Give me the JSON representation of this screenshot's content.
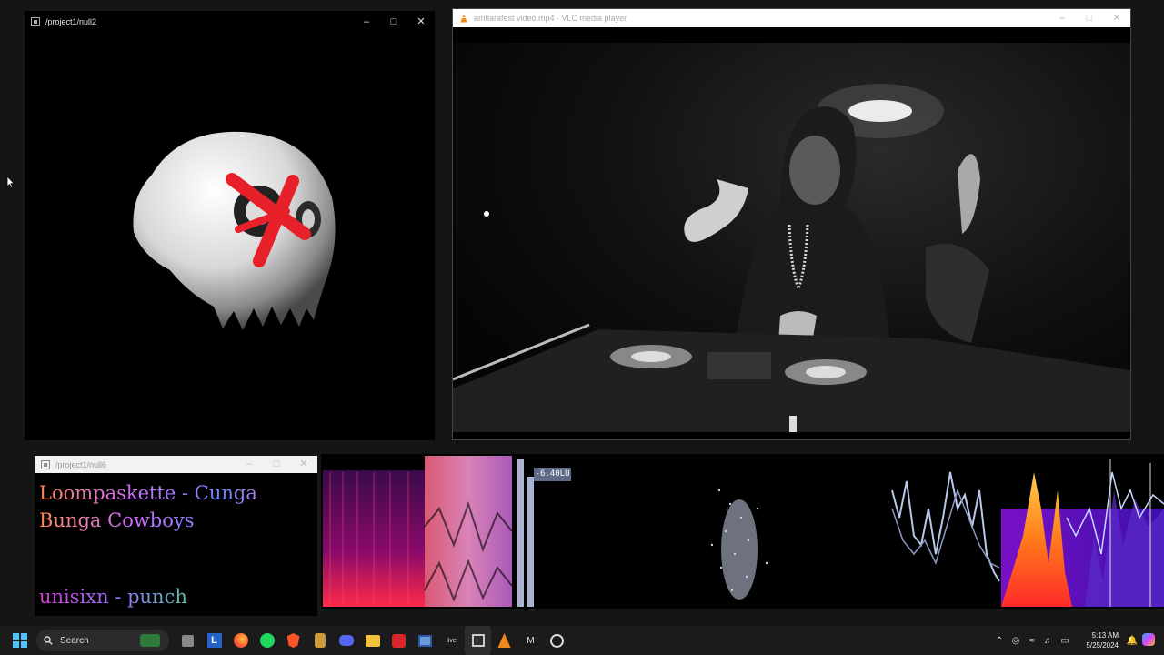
{
  "windows": {
    "null2": {
      "title": "/project1/null2",
      "controls": {
        "minimize": "–",
        "maximize": "□",
        "close": "✕"
      }
    },
    "vlc": {
      "title": "amflarafest video.mp4 - VLC media player",
      "controls": {
        "minimize": "–",
        "maximize": "□",
        "close": "✕"
      }
    },
    "null6": {
      "title": "/project1/null6",
      "controls": {
        "minimize": "–",
        "maximize": "□",
        "close": "✕"
      },
      "now_playing": "Loompaskette - Cunga Bunga Cowboys",
      "next_track": "unisixn - punch"
    }
  },
  "visualizer": {
    "loudness_label": "-6.40LU"
  },
  "taskbar": {
    "search_label": "Search",
    "apps": [
      "start-icon",
      "search",
      "file-manager-icon",
      "letter-l-app-icon",
      "firefox-icon",
      "spotify-icon",
      "brave-icon",
      "app-icon",
      "discord-icon",
      "folder-icon",
      "flash-app-icon",
      "window-app-icon",
      "live-app-icon",
      "touchdesigner-icon",
      "vlc-icon",
      "max-app-icon",
      "obs-icon"
    ],
    "live_label": "live",
    "clock": {
      "time": "5:13 AM",
      "date": "5/25/2024"
    },
    "tray_icons": [
      "chevron-up-icon",
      "mic-icon",
      "wifi-icon",
      "speaker-icon",
      "battery-icon",
      "bell-icon",
      "copilot-icon"
    ]
  },
  "colors": {
    "taskbar_bg": "#1b1b1b",
    "accent_red": "#e8202a",
    "lu_badge": "#5e6a86"
  }
}
